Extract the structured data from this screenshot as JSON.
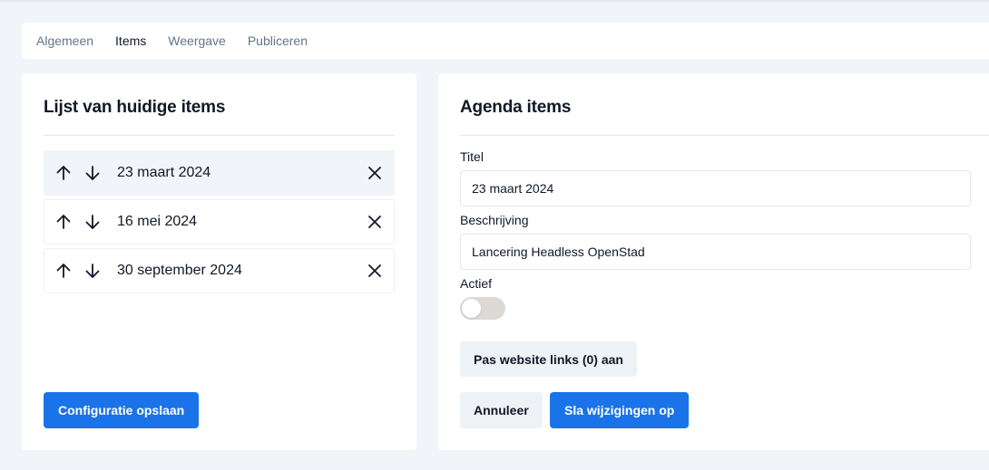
{
  "tabs": [
    {
      "label": "Algemeen",
      "active": false
    },
    {
      "label": "Items",
      "active": true
    },
    {
      "label": "Weergave",
      "active": false
    },
    {
      "label": "Publiceren",
      "active": false
    }
  ],
  "left_panel": {
    "title": "Lijst van huidige items",
    "items": [
      {
        "label": "23 maart 2024",
        "selected": true
      },
      {
        "label": "16 mei 2024",
        "selected": false
      },
      {
        "label": "30 september 2024",
        "selected": false
      }
    ],
    "save_button": "Configuratie opslaan"
  },
  "right_panel": {
    "title": "Agenda items",
    "title_field": {
      "label": "Titel",
      "value": "23 maart 2024"
    },
    "description_field": {
      "label": "Beschrijving",
      "value": "Lancering Headless OpenStad"
    },
    "active_field": {
      "label": "Actief",
      "on": false
    },
    "links_button": "Pas website links (0) aan",
    "cancel_button": "Annuleer",
    "submit_button": "Sla wijzigingen op"
  },
  "colors": {
    "primary": "#1a73e8",
    "background": "#f1f4f8",
    "toggle_off": "#ddd9d6"
  },
  "icons": {
    "up": "arrow-up-icon",
    "down": "arrow-down-icon",
    "remove": "close-icon"
  }
}
